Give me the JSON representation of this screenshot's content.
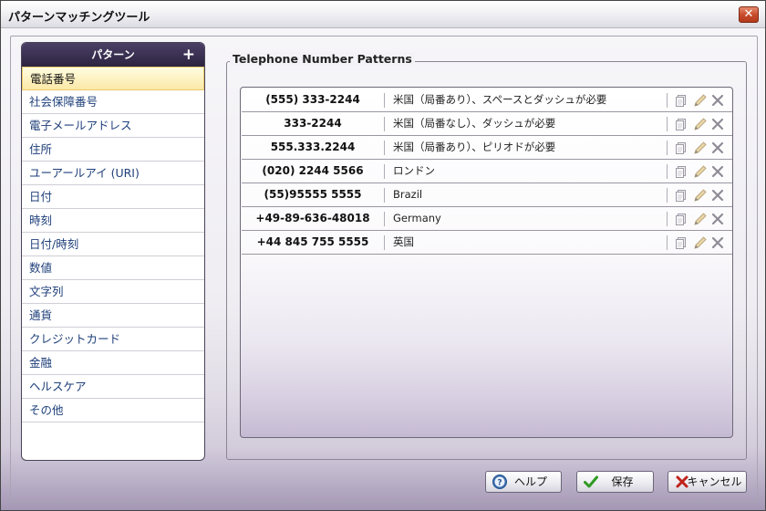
{
  "window": {
    "title": "パターンマッチングツール",
    "close_label": "✕"
  },
  "categories": {
    "header": "パターン",
    "add_label": "+",
    "items": [
      "電話番号",
      "社会保障番号",
      "電子メールアドレス",
      "住所",
      "ユーアールアイ (URI)",
      "日付",
      "時刻",
      "日付/時刻",
      "数値",
      "文字列",
      "通貨",
      "クレジットカード",
      "金融",
      "ヘルスケア",
      "その他"
    ],
    "selected_index": 0
  },
  "patterns": {
    "group_title": "Telephone Number Patterns",
    "rows": [
      {
        "number": "(555) 333-2244",
        "description": "米国（局番あり）、スペースとダッシュが必要"
      },
      {
        "number": "333-2244",
        "description": "米国（局番なし）、ダッシュが必要"
      },
      {
        "number": "555.333.2244",
        "description": "米国（局番あり）、ピリオドが必要"
      },
      {
        "number": "(020) 2244 5566",
        "description": "ロンドン"
      },
      {
        "number": "(55)95555 5555",
        "description": "Brazil"
      },
      {
        "number": "+49-89-636-48018",
        "description": "Germany"
      },
      {
        "number": "+44 845 755 5555",
        "description": "英国"
      }
    ]
  },
  "buttons": {
    "help": "ヘルプ",
    "save": "保存",
    "cancel": "キャンセル"
  },
  "colors": {
    "accent": "#2c2540",
    "link_text": "#1e3f7a",
    "selected_bg": "#fbe9a7",
    "close_red": "#c94d2c",
    "save_check": "#2e9a22",
    "cancel_x": "#c0231a",
    "help_blue": "#3d6fb0"
  },
  "icons": {
    "row_actions": [
      "copy-icon",
      "edit-pencil-icon",
      "delete-x-icon"
    ],
    "help": "question-circle-icon",
    "save": "checkmark-icon",
    "cancel": "x-icon"
  }
}
